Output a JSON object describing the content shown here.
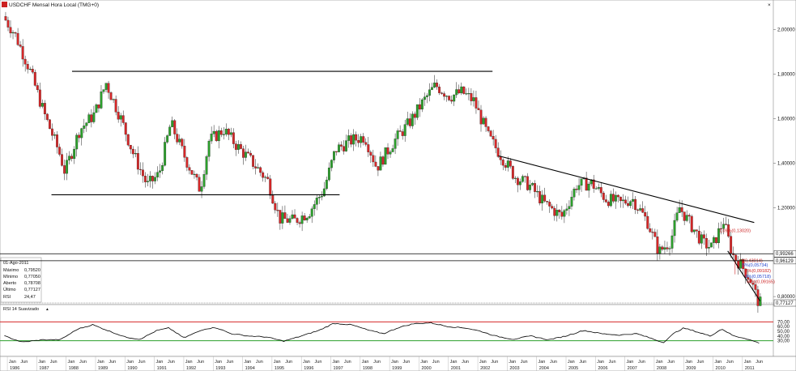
{
  "window": {
    "symbol_icon": "chart-app-icon",
    "title": "USDCHF Mensal Hora Local (TMG+0)",
    "close_glyph": "×",
    "scroll_glyph": "▴"
  },
  "info_box": {
    "date": "01-Ago-2011",
    "rows": [
      {
        "label": "Máximo",
        "value": "0,79520"
      },
      {
        "label": "Mínimo",
        "value": "0,77050"
      },
      {
        "label": "Aberto",
        "value": "0,78708"
      },
      {
        "label": "Último",
        "value": "0,77127"
      },
      {
        "label": "RSI",
        "value": "24,47"
      }
    ]
  },
  "price_axis": {
    "labels": [
      "2,00000",
      "1,80000",
      "1,60000",
      "1,40000",
      "1,20000",
      "0,80000"
    ],
    "values": [
      2.0,
      1.8,
      1.6,
      1.4,
      1.2,
      0.8
    ],
    "range": [
      0.7713,
      2.09
    ],
    "h_levels": [
      {
        "label": "0,99266",
        "value": 0.99266
      },
      {
        "label": "0,96129",
        "value": 0.96129
      }
    ],
    "last": {
      "label": "0,77127",
      "value": 0.77127
    }
  },
  "rsi": {
    "title": "RSI 14 Suavizado",
    "range": [
      0,
      100
    ],
    "labels": [
      "70,00",
      "60,00",
      "50,00",
      "40,00",
      "30,00"
    ],
    "values": [
      70,
      60,
      50,
      40,
      30
    ],
    "overbought": 70,
    "oversold": 30
  },
  "fib_labels": [
    {
      "text": "1,09%(0,13020)",
      "color": "#cc2222"
    },
    {
      "text": "%(0,43014)",
      "color": "#cc2222"
    },
    {
      "text": "5%(0,05734)",
      "color": "#2244cc"
    },
    {
      "text": "2%(0,09182)",
      "color": "#cc2222"
    },
    {
      "text": "0%(0,05718)",
      "color": "#2244cc"
    },
    {
      "text": "65%(0,09165)",
      "color": "#cc2222"
    }
  ],
  "time_axis": {
    "months": [
      "Jan",
      "Jun"
    ],
    "years": [
      "1986",
      "1987",
      "1988",
      "1989",
      "1990",
      "1991",
      "1992",
      "1993",
      "1994",
      "1995",
      "1996",
      "1997",
      "1998",
      "1999",
      "2000",
      "2001",
      "2002",
      "2003",
      "2004",
      "2005",
      "2006",
      "2007",
      "2008",
      "2009",
      "2010",
      "2011"
    ]
  },
  "colors": {
    "bull": "#2ca02c",
    "bear": "#d62728",
    "trend": "#000000",
    "rsi_line": "#000000",
    "rsi_ob": "#d62728",
    "rsi_os": "#2ca02c"
  },
  "chart_data": {
    "type": "candlestick",
    "title": "USDCHF Mensal Hora Local (TMG+0)",
    "y_range": [
      0.7713,
      2.09
    ],
    "x_range": [
      "1986",
      "2011"
    ],
    "anchors": [
      {
        "t": 1985.9,
        "p": 2.06
      },
      {
        "t": 1986.3,
        "p": 1.98
      },
      {
        "t": 1986.8,
        "p": 1.82
      },
      {
        "t": 1987.3,
        "p": 1.62
      },
      {
        "t": 1987.8,
        "p": 1.45
      },
      {
        "t": 1988.0,
        "p": 1.36
      },
      {
        "t": 1988.5,
        "p": 1.55
      },
      {
        "t": 1989.0,
        "p": 1.62
      },
      {
        "t": 1989.4,
        "p": 1.76
      },
      {
        "t": 1989.9,
        "p": 1.6
      },
      {
        "t": 1990.3,
        "p": 1.45
      },
      {
        "t": 1990.8,
        "p": 1.3
      },
      {
        "t": 1991.2,
        "p": 1.35
      },
      {
        "t": 1991.6,
        "p": 1.58
      },
      {
        "t": 1992.1,
        "p": 1.42
      },
      {
        "t": 1992.6,
        "p": 1.28
      },
      {
        "t": 1992.9,
        "p": 1.5
      },
      {
        "t": 1993.4,
        "p": 1.55
      },
      {
        "t": 1993.9,
        "p": 1.47
      },
      {
        "t": 1994.4,
        "p": 1.4
      },
      {
        "t": 1994.9,
        "p": 1.32
      },
      {
        "t": 1995.3,
        "p": 1.15
      },
      {
        "t": 1995.8,
        "p": 1.14
      },
      {
        "t": 1996.3,
        "p": 1.18
      },
      {
        "t": 1996.8,
        "p": 1.28
      },
      {
        "t": 1997.2,
        "p": 1.46
      },
      {
        "t": 1997.7,
        "p": 1.5
      },
      {
        "t": 1998.2,
        "p": 1.52
      },
      {
        "t": 1998.6,
        "p": 1.38
      },
      {
        "t": 1999.2,
        "p": 1.5
      },
      {
        "t": 1999.7,
        "p": 1.58
      },
      {
        "t": 2000.2,
        "p": 1.68
      },
      {
        "t": 2000.6,
        "p": 1.75
      },
      {
        "t": 2001.1,
        "p": 1.7
      },
      {
        "t": 2001.5,
        "p": 1.72
      },
      {
        "t": 2001.9,
        "p": 1.68
      },
      {
        "t": 2002.4,
        "p": 1.52
      },
      {
        "t": 2002.9,
        "p": 1.42
      },
      {
        "t": 2003.3,
        "p": 1.34
      },
      {
        "t": 2003.8,
        "p": 1.3
      },
      {
        "t": 2004.3,
        "p": 1.22
      },
      {
        "t": 2004.9,
        "p": 1.16
      },
      {
        "t": 2005.4,
        "p": 1.3
      },
      {
        "t": 2005.9,
        "p": 1.31
      },
      {
        "t": 2006.4,
        "p": 1.24
      },
      {
        "t": 2006.9,
        "p": 1.22
      },
      {
        "t": 2007.3,
        "p": 1.24
      },
      {
        "t": 2007.8,
        "p": 1.14
      },
      {
        "t": 2008.2,
        "p": 1.0
      },
      {
        "t": 2008.6,
        "p": 1.05
      },
      {
        "t": 2008.9,
        "p": 1.2
      },
      {
        "t": 2009.3,
        "p": 1.12
      },
      {
        "t": 2009.7,
        "p": 1.04
      },
      {
        "t": 2010.0,
        "p": 1.02
      },
      {
        "t": 2010.4,
        "p": 1.14
      },
      {
        "t": 2010.7,
        "p": 0.99
      },
      {
        "t": 2011.0,
        "p": 0.94
      },
      {
        "t": 2011.3,
        "p": 0.88
      },
      {
        "t": 2011.6,
        "p": 0.77
      }
    ],
    "trend_lines": [
      {
        "t1": 1988.2,
        "p1": 1.813,
        "t2": 2002.5,
        "p2": 1.813
      },
      {
        "t1": 1987.5,
        "p1": 1.258,
        "t2": 1997.3,
        "p2": 1.258
      },
      {
        "t1": 2002.7,
        "p1": 1.433,
        "t2": 2011.4,
        "p2": 1.133
      },
      {
        "t1": 2010.5,
        "p1": 1.005,
        "t2": 2011.6,
        "p2": 0.78
      }
    ],
    "rsi_anchors": [
      {
        "t": 1985.9,
        "v": 40
      },
      {
        "t": 1986.5,
        "v": 27
      },
      {
        "t": 1987.2,
        "v": 32
      },
      {
        "t": 1987.8,
        "v": 32
      },
      {
        "t": 1988.4,
        "v": 55
      },
      {
        "t": 1988.9,
        "v": 64
      },
      {
        "t": 1989.4,
        "v": 52
      },
      {
        "t": 1990.0,
        "v": 38
      },
      {
        "t": 1990.5,
        "v": 33
      },
      {
        "t": 1991.1,
        "v": 52
      },
      {
        "t": 1991.5,
        "v": 57
      },
      {
        "t": 1992.0,
        "v": 36
      },
      {
        "t": 1992.7,
        "v": 55
      },
      {
        "t": 1993.1,
        "v": 58
      },
      {
        "t": 1993.6,
        "v": 45
      },
      {
        "t": 1994.2,
        "v": 40
      },
      {
        "t": 1994.8,
        "v": 38
      },
      {
        "t": 1995.4,
        "v": 29
      },
      {
        "t": 1996.0,
        "v": 40
      },
      {
        "t": 1996.6,
        "v": 52
      },
      {
        "t": 1997.1,
        "v": 67
      },
      {
        "t": 1997.7,
        "v": 64
      },
      {
        "t": 1998.3,
        "v": 52
      },
      {
        "t": 1998.8,
        "v": 45
      },
      {
        "t": 1999.3,
        "v": 58
      },
      {
        "t": 1999.8,
        "v": 66
      },
      {
        "t": 2000.4,
        "v": 68
      },
      {
        "t": 2001.0,
        "v": 60
      },
      {
        "t": 2001.6,
        "v": 57
      },
      {
        "t": 2002.1,
        "v": 50
      },
      {
        "t": 2002.6,
        "v": 40
      },
      {
        "t": 2003.2,
        "v": 33
      },
      {
        "t": 2003.8,
        "v": 40
      },
      {
        "t": 2004.4,
        "v": 32
      },
      {
        "t": 2005.0,
        "v": 40
      },
      {
        "t": 2005.6,
        "v": 52
      },
      {
        "t": 2006.2,
        "v": 45
      },
      {
        "t": 2006.8,
        "v": 42
      },
      {
        "t": 2007.4,
        "v": 45
      },
      {
        "t": 2007.9,
        "v": 35
      },
      {
        "t": 2008.3,
        "v": 26
      },
      {
        "t": 2008.7,
        "v": 47
      },
      {
        "t": 2009.0,
        "v": 57
      },
      {
        "t": 2009.5,
        "v": 48
      },
      {
        "t": 2009.9,
        "v": 40
      },
      {
        "t": 2010.3,
        "v": 55
      },
      {
        "t": 2010.7,
        "v": 40
      },
      {
        "t": 2011.1,
        "v": 35
      },
      {
        "t": 2011.6,
        "v": 24.47
      }
    ]
  }
}
